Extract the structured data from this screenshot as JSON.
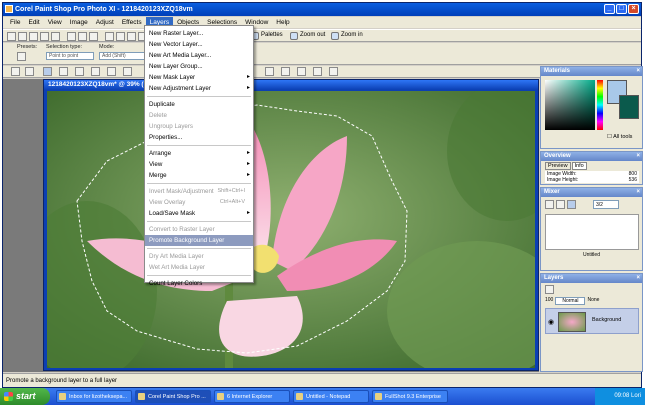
{
  "window": {
    "title": "Corel Paint Shop Pro Photo XI - 1218420123XZQ18vm"
  },
  "menubar": [
    "File",
    "Edit",
    "View",
    "Image",
    "Adjust",
    "Effects",
    "Layers",
    "Objects",
    "Selections",
    "Window",
    "Help"
  ],
  "toolbar_right": {
    "palettes": "Palettes",
    "zoom_out": "Zoom out",
    "zoom_in": "Zoom in"
  },
  "tool_options": {
    "presets_label": "Presets:",
    "selection_type_label": "Selection type:",
    "selection_type_value": "Point to point",
    "mode_label": "Mode:",
    "mode_value": "Add (Shift)"
  },
  "image_window": {
    "title": "1218420123XZQ18vm* @ 39% (Background)"
  },
  "layers_menu": {
    "items": [
      {
        "label": "New Raster Layer...",
        "shortcut": "",
        "arrow": false,
        "disabled": false,
        "highlight": false
      },
      {
        "label": "New Vector Layer...",
        "shortcut": "",
        "arrow": false,
        "disabled": false,
        "highlight": false
      },
      {
        "label": "New Art Media Layer...",
        "shortcut": "",
        "arrow": false,
        "disabled": false,
        "highlight": false
      },
      {
        "label": "New Layer Group...",
        "shortcut": "",
        "arrow": false,
        "disabled": false,
        "highlight": false
      },
      {
        "label": "New Mask Layer",
        "shortcut": "",
        "arrow": true,
        "disabled": false,
        "highlight": false
      },
      {
        "label": "New Adjustment Layer",
        "shortcut": "",
        "arrow": true,
        "disabled": false,
        "highlight": false
      },
      {
        "sep": true
      },
      {
        "label": "Duplicate",
        "shortcut": "",
        "arrow": false,
        "disabled": false,
        "highlight": false
      },
      {
        "label": "Delete",
        "shortcut": "",
        "arrow": false,
        "disabled": true,
        "highlight": false
      },
      {
        "label": "Ungroup Layers",
        "shortcut": "",
        "arrow": false,
        "disabled": true,
        "highlight": false
      },
      {
        "label": "Properties...",
        "shortcut": "",
        "arrow": false,
        "disabled": false,
        "highlight": false
      },
      {
        "sep": true
      },
      {
        "label": "Arrange",
        "shortcut": "",
        "arrow": true,
        "disabled": false,
        "highlight": false
      },
      {
        "label": "View",
        "shortcut": "",
        "arrow": true,
        "disabled": false,
        "highlight": false
      },
      {
        "label": "Merge",
        "shortcut": "",
        "arrow": true,
        "disabled": false,
        "highlight": false
      },
      {
        "sep": true
      },
      {
        "label": "Invert Mask/Adjustment",
        "shortcut": "Shift+Ctrl+I",
        "arrow": false,
        "disabled": true,
        "highlight": false
      },
      {
        "label": "View Overlay",
        "shortcut": "Ctrl+Alt+V",
        "arrow": false,
        "disabled": true,
        "highlight": false
      },
      {
        "label": "Load/Save Mask",
        "shortcut": "",
        "arrow": true,
        "disabled": false,
        "highlight": false
      },
      {
        "sep": true
      },
      {
        "label": "Convert to Raster Layer",
        "shortcut": "",
        "arrow": false,
        "disabled": true,
        "highlight": false
      },
      {
        "label": "Promote Background Layer",
        "shortcut": "",
        "arrow": false,
        "disabled": false,
        "highlight": true
      },
      {
        "sep": true
      },
      {
        "label": "Dry Art Media Layer",
        "shortcut": "",
        "arrow": false,
        "disabled": true,
        "highlight": false
      },
      {
        "label": "Wet Art Media Layer",
        "shortcut": "",
        "arrow": false,
        "disabled": true,
        "highlight": false
      },
      {
        "sep": true
      },
      {
        "label": "Count Layer Colors",
        "shortcut": "",
        "arrow": false,
        "disabled": false,
        "highlight": false
      }
    ]
  },
  "palettes": {
    "materials": {
      "title": "Materials",
      "all_tools": "All tools"
    },
    "overview": {
      "title": "Overview",
      "tab_preview": "Preview",
      "tab_info": "Info",
      "image_width_label": "Image Width:",
      "image_width": "800",
      "image_height_label": "Image Height:",
      "image_height": "536"
    },
    "mixer": {
      "title": "Mixer",
      "size_value": "3/2",
      "untitled": "Untitled"
    },
    "layers": {
      "title": "Layers",
      "opacity": "100",
      "blend": "Normal",
      "none": "None",
      "layer_name": "Background"
    }
  },
  "status": {
    "text": "Promote a background layer to a full layer"
  },
  "taskbar": {
    "start": "start",
    "tasks": [
      "Inbox for lizotheksepa...",
      "Corel Paint Shop Pro ...",
      "6 Internet Explorer",
      "Untitled - Notepad",
      "FullShot 9.3 Enterprise"
    ],
    "clock": "09:08 Lori"
  },
  "colors": {
    "accent": "#316ac5",
    "highlight": "#8d9bbf",
    "titlebar": "#0a5ee0"
  }
}
